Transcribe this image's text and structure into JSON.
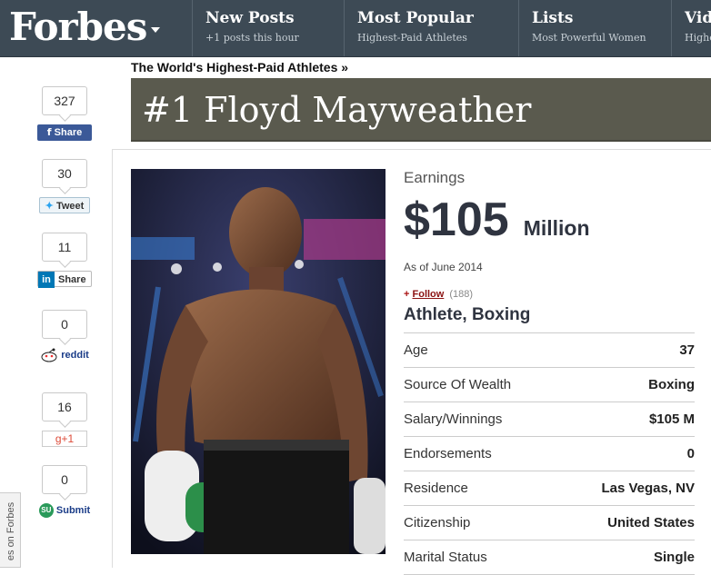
{
  "site": {
    "logo": "Forbes"
  },
  "nav": [
    {
      "title": "New Posts",
      "sub": "+1 posts this hour"
    },
    {
      "title": "Most Popular",
      "sub": "Highest-Paid Athletes"
    },
    {
      "title": "Lists",
      "sub": "Most Powerful Women"
    },
    {
      "title": "Vid",
      "sub": "Highe"
    }
  ],
  "breadcrumb": "The World's Highest-Paid Athletes »",
  "page_title": "#1 Floyd Mayweather",
  "social": {
    "facebook": {
      "count": "327",
      "label": "Share"
    },
    "twitter": {
      "count": "30",
      "label": "Tweet"
    },
    "linkedin": {
      "count": "11",
      "label": "Share",
      "logo": "in"
    },
    "reddit": {
      "count": "0",
      "label": "reddit"
    },
    "gplus": {
      "count": "16",
      "label": "g+1"
    },
    "stumbleupon": {
      "count": "0",
      "label": "Submit"
    }
  },
  "side_tab": "es on Forbes",
  "profile": {
    "earnings_label": "Earnings",
    "earnings_amount": "$105",
    "earnings_unit": "Million",
    "as_of": "As of June 2014",
    "follow_label": "Follow",
    "follow_count": "(188)",
    "category": "Athlete, Boxing",
    "facts": [
      {
        "label": "Age",
        "value": "37"
      },
      {
        "label": "Source Of Wealth",
        "value": "Boxing"
      },
      {
        "label": "Salary/Winnings",
        "value": "$105 M"
      },
      {
        "label": "Endorsements",
        "value": "0"
      },
      {
        "label": "Residence",
        "value": "Las Vegas, NV"
      },
      {
        "label": "Citizenship",
        "value": "United States"
      },
      {
        "label": "Marital Status",
        "value": "Single"
      }
    ]
  },
  "colors": {
    "nav_bg": "#3d4a55",
    "title_bar": "#5a5a4e",
    "facebook": "#3b5998",
    "follow": "#8b1111"
  }
}
